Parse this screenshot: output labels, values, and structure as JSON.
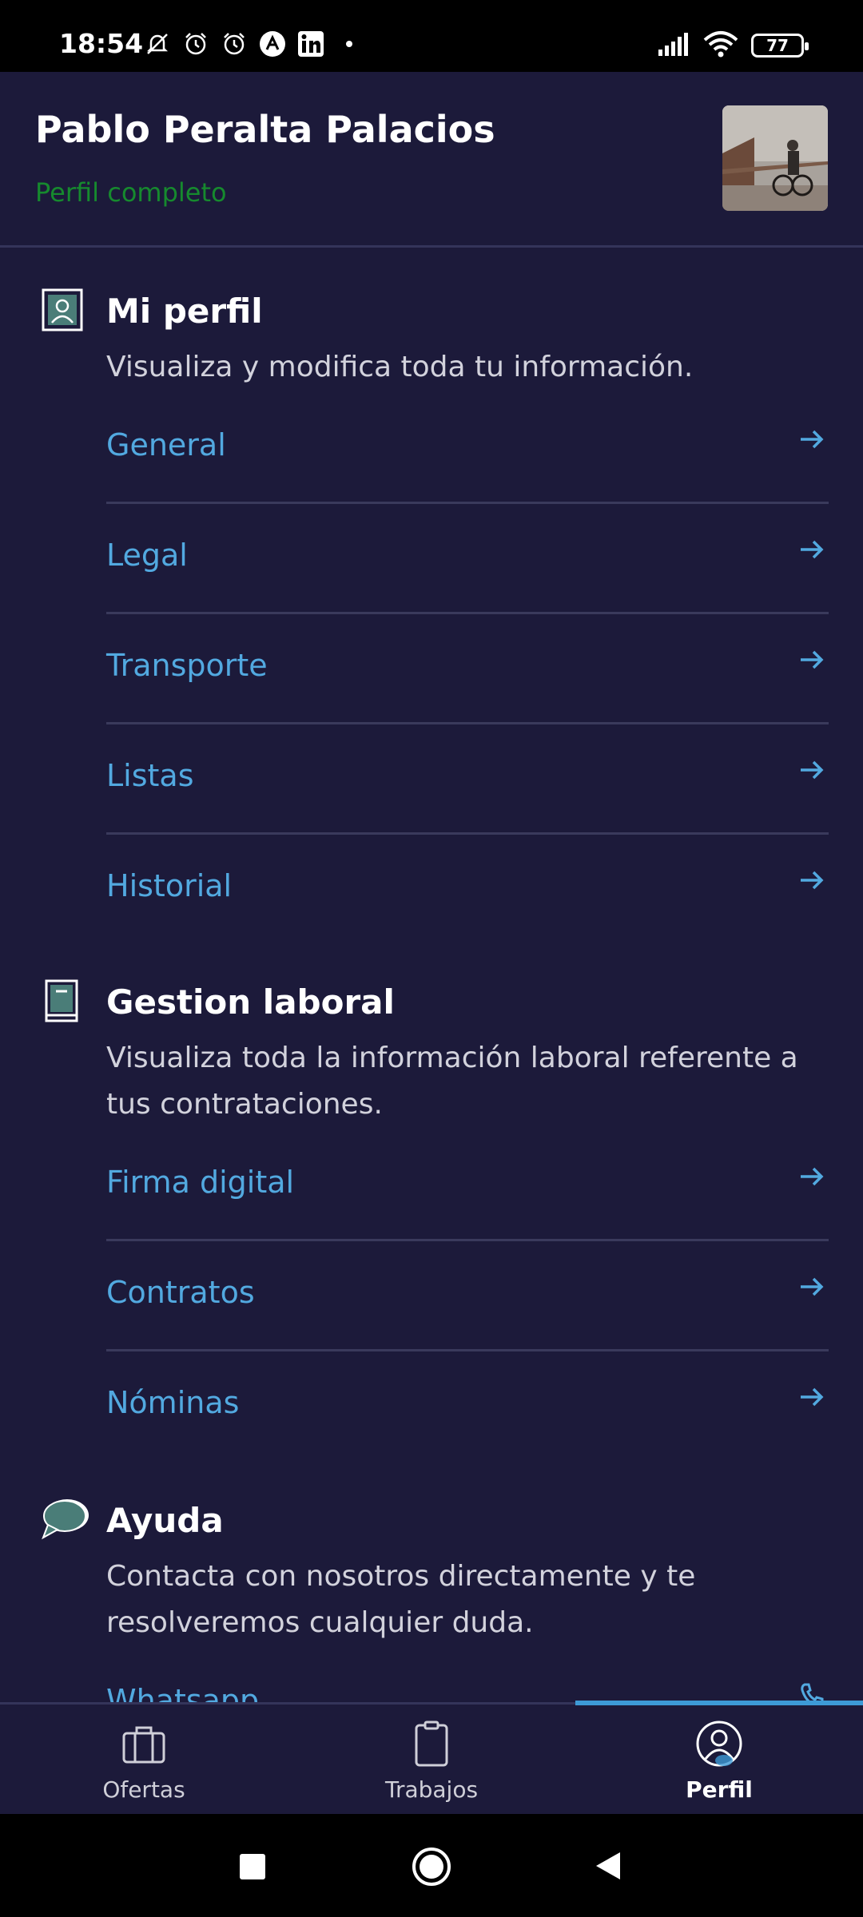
{
  "status_bar": {
    "time": "18:54",
    "battery": "77",
    "left_icons": [
      "bell-off-icon",
      "alarm-icon",
      "alarm-icon",
      "app-icon",
      "linkedin-icon",
      "dot-icon"
    ],
    "right_icons": [
      "signal-icon",
      "wifi-icon",
      "battery-icon"
    ]
  },
  "header": {
    "user_name": "Pablo Peralta Palacios",
    "profile_status": "Perfil completo",
    "status_color": "#168a2e"
  },
  "sections": {
    "profile": {
      "title": "Mi perfil",
      "description": "Visualiza y modifica toda tu información.",
      "icon": "profile-card-icon",
      "items": [
        {
          "label": "General"
        },
        {
          "label": "Legal"
        },
        {
          "label": "Transporte"
        },
        {
          "label": "Listas"
        },
        {
          "label": "Historial"
        }
      ]
    },
    "work": {
      "title": "Gestion laboral",
      "description": "Visualiza toda la información laboral referente a tus contrataciones.",
      "icon": "book-icon",
      "items": [
        {
          "label": "Firma digital"
        },
        {
          "label": "Contratos"
        },
        {
          "label": "Nóminas"
        }
      ]
    },
    "help": {
      "title": "Ayuda",
      "description": "Contacta con nosotros directamente y te resolveremos cualquier duda.",
      "icon": "chat-bubble-icon",
      "items": [
        {
          "label": "Whatsapp"
        }
      ]
    }
  },
  "bottom_nav": {
    "tabs": [
      {
        "label": "Ofertas",
        "icon": "briefcase-icon"
      },
      {
        "label": "Trabajos",
        "icon": "clipboard-icon"
      },
      {
        "label": "Perfil",
        "icon": "user-circle-icon",
        "active": true
      }
    ],
    "active_color": "#3d9ad6"
  },
  "colors": {
    "background": "#1c1a3a",
    "link": "#52a9e0",
    "accent": "#3d9ad6"
  }
}
